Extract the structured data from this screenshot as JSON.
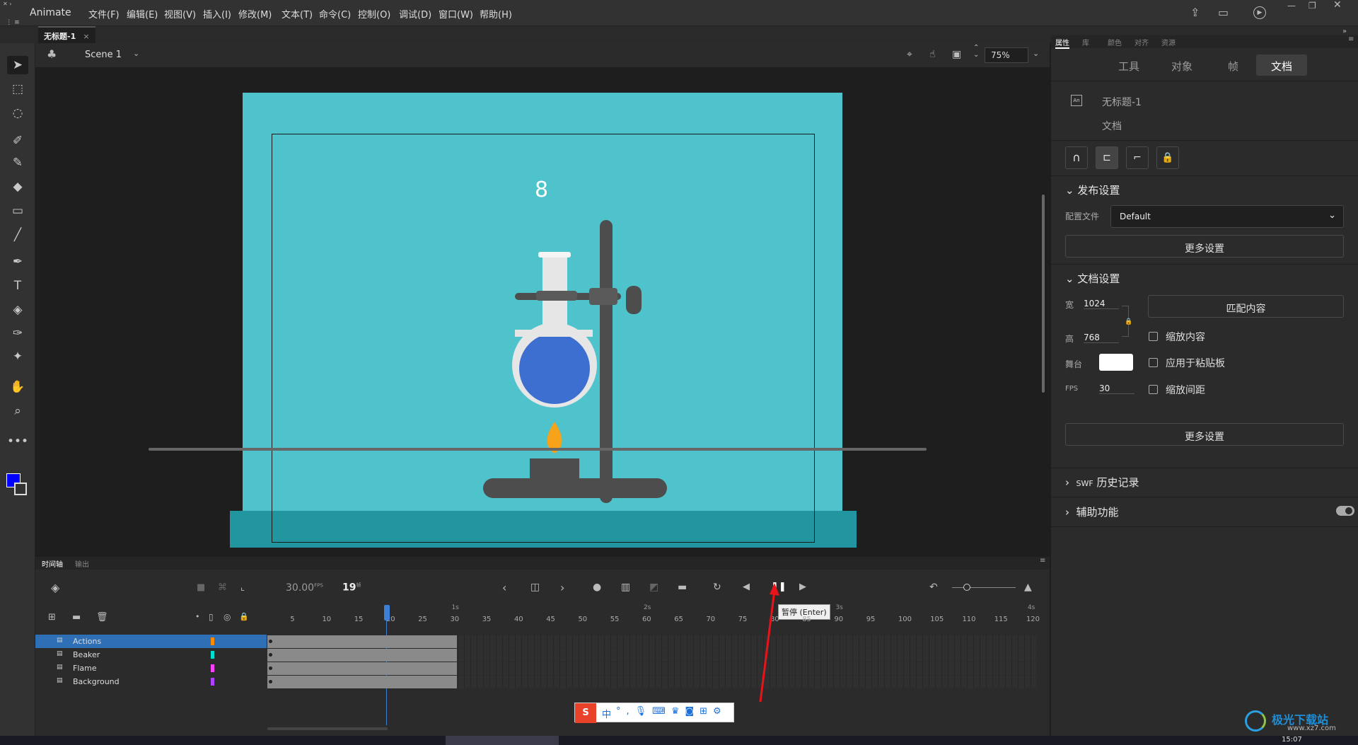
{
  "app": {
    "name": "Animate"
  },
  "menu": [
    "文件(F)",
    "编辑(E)",
    "视图(V)",
    "插入(I)",
    "修改(M)",
    "文本(T)",
    "命令(C)",
    "控制(O)",
    "调试(D)",
    "窗口(W)",
    "帮助(H)"
  ],
  "doc_tab": {
    "title": "无标题-1",
    "close": "×"
  },
  "scene": {
    "name": "Scene 1",
    "zoom": "75%"
  },
  "stage": {
    "frame_number": "8",
    "bg_color": "#4fc3cc",
    "floor_color": "#2196a0"
  },
  "props": {
    "tabs": [
      "属性",
      "库",
      "颜色",
      "对齐",
      "资源"
    ],
    "subtabs": [
      "工具",
      "对象",
      "帧",
      "文档"
    ],
    "active_subtab": "文档",
    "doc_name": "无标题-1",
    "doc_type": "文档",
    "publish": {
      "title": "发布设置",
      "profile_label": "配置文件",
      "profile_value": "Default",
      "more": "更多设置"
    },
    "docset": {
      "title": "文档设置",
      "width_label": "宽",
      "width": "1024",
      "height_label": "高",
      "height": "768",
      "match": "匹配内容",
      "scale_content": "缩放内容",
      "stage_label": "舞台",
      "apply_paste": "应用于粘贴板",
      "fps_label": "FPS",
      "fps": "30",
      "scale_spacing": "缩放间距",
      "more": "更多设置"
    },
    "swf": {
      "prefix": "SWF",
      "title": "历史记录"
    },
    "access": {
      "title": "辅助功能"
    }
  },
  "timeline": {
    "tabs": [
      "时间轴",
      "输出"
    ],
    "fps": "30.00",
    "fps_unit": "FPS",
    "frame": "19",
    "frame_unit": "帧",
    "tooltip": "暂停 (Enter)",
    "ruler": [
      "5",
      "10",
      "15",
      "20",
      "25",
      "30",
      "35",
      "40",
      "45",
      "50",
      "55",
      "60",
      "65",
      "70",
      "75",
      "80",
      "85",
      "90",
      "95",
      "100",
      "105",
      "110",
      "115",
      "120"
    ],
    "seconds": [
      "1s",
      "2s",
      "3s",
      "4s"
    ],
    "layers": [
      {
        "name": "Actions",
        "color": "#ff8a00"
      },
      {
        "name": "Beaker",
        "color": "#00e0d0"
      },
      {
        "name": "Flame",
        "color": "#ff40ff"
      },
      {
        "name": "Background",
        "color": "#b040ff"
      }
    ]
  },
  "ime": {
    "label": "中"
  },
  "watermark": {
    "text": "极光下载站",
    "url": "www.xz7.com"
  },
  "taskbar": {
    "time": "15:07"
  },
  "colors": {
    "accent": "#2f6fb5",
    "fill": "#0000ff"
  }
}
